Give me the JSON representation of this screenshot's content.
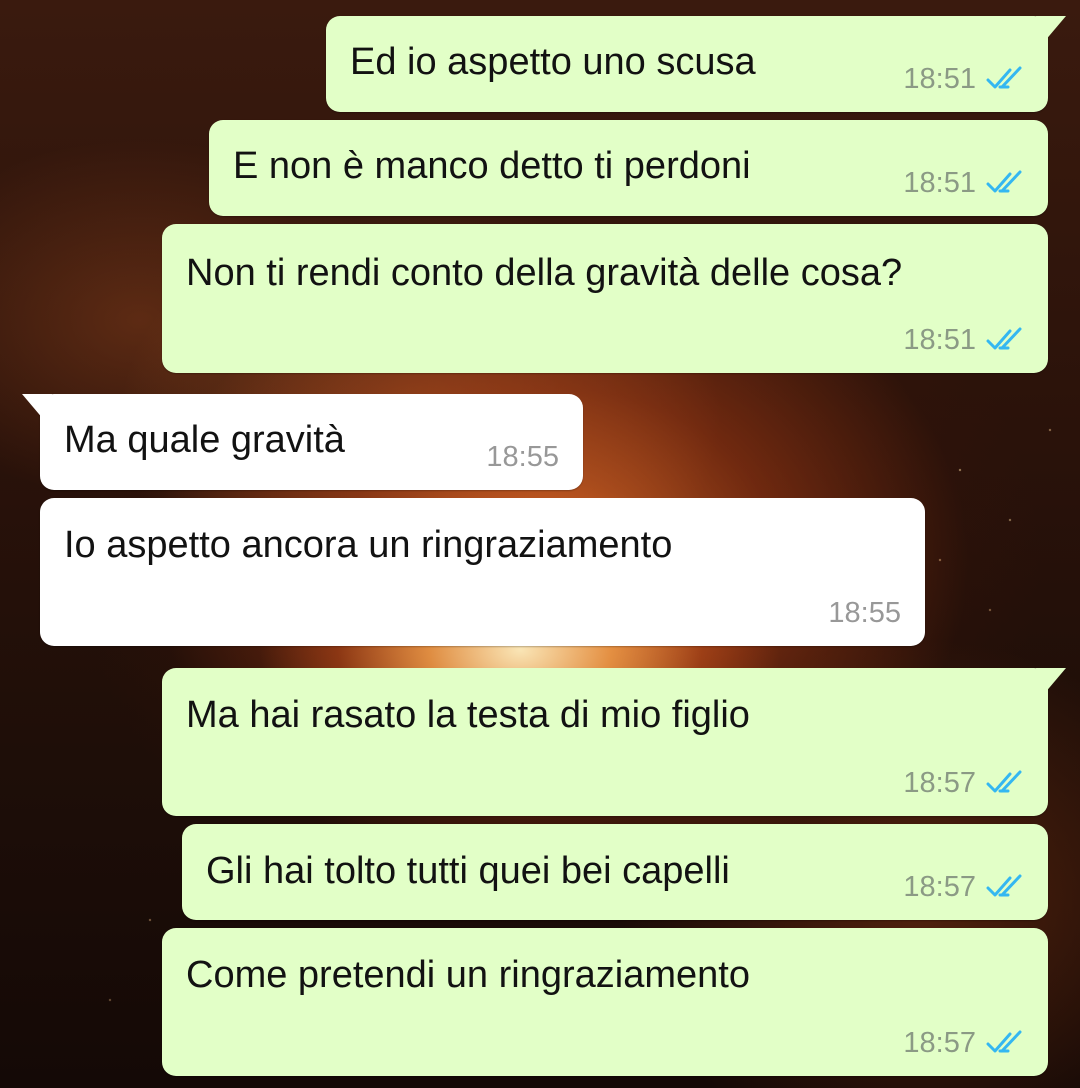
{
  "chat": {
    "messages": [
      {
        "direction": "out",
        "text": "Ed io aspetto uno scusa",
        "time": "18:51",
        "status": "read"
      },
      {
        "direction": "out",
        "text": "E non è manco detto ti perdoni",
        "time": "18:51",
        "status": "read"
      },
      {
        "direction": "out",
        "text": "Non ti rendi conto della gravità delle cosa?",
        "time": "18:51",
        "status": "read"
      },
      {
        "direction": "in",
        "text": "Ma quale gravità",
        "time": "18:55"
      },
      {
        "direction": "in",
        "text": "Io aspetto ancora un ringraziamento",
        "time": "18:55"
      },
      {
        "direction": "out",
        "text": "Ma hai rasato la testa di mio figlio",
        "time": "18:57",
        "status": "read"
      },
      {
        "direction": "out",
        "text": "Gli hai tolto tutti quei bei capelli",
        "time": "18:57",
        "status": "read"
      },
      {
        "direction": "out",
        "text": "Come pretendi un ringraziamento",
        "time": "18:57",
        "status": "read"
      }
    ]
  },
  "colors": {
    "outgoing_bubble": "#e2ffc7",
    "incoming_bubble": "#ffffff",
    "read_ticks": "#34b7f1",
    "text": "#121212"
  },
  "icons": {
    "read_status": "double-check-icon"
  }
}
